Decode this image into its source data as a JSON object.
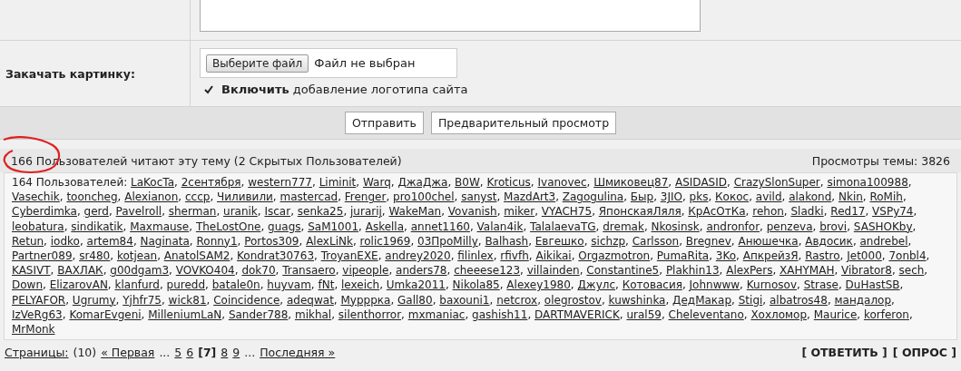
{
  "form": {
    "upload_label": "Закачать картинку:",
    "file_button": "Выберите файл",
    "file_status": "Файл не выбран",
    "logo_checkbox": {
      "label": "**Включить** добавление логотипа сайта",
      "checked": true
    },
    "buttons": [
      "Отправить",
      "Предварительный просмотр"
    ]
  },
  "readers": {
    "title": "166 Пользователей читают эту тему (2 Скрытых Пользователей)",
    "views": "Просмотры темы: 3826",
    "prefix": "164 Пользователей:",
    "separator": ",",
    "users": [
      "LaKocTa",
      "2сентября",
      "western777",
      "Liminit",
      "Warq",
      "ДжаДжа",
      "B0W",
      "Kroticus",
      "Ivanovec",
      "Шмиковец87",
      "ASIDASID",
      "CrazySlonSuper",
      "simona100988",
      "Vasechik",
      "tooncheg",
      "Alexianon",
      "cccp",
      "Чиливили",
      "mastercad",
      "Frenger",
      "pro100chel",
      "sanyst",
      "MazdArt3",
      "Zagogulina",
      "Быр",
      "3JIO",
      "pks",
      "Кокос",
      "avild",
      "alakond",
      "Nkin",
      "RoMih",
      "Cyberdimka",
      "gerd",
      "Pavelroll",
      "sherman",
      "uranik",
      "Iscar",
      "senka25",
      "jurarij",
      "WakeMan",
      "Vovanish",
      "miker",
      "VYACH75",
      "ЯпонскаяЛяля",
      "КрАсОтКа",
      "rehon",
      "Sladki",
      "Red17",
      "VSPy74",
      "leobatura",
      "sindikatik",
      "Maxmause",
      "TheLostOne",
      "guags",
      "SaM1001",
      "Askella",
      "annet1160",
      "Valan4ik",
      "TalalaevaTG",
      "dremak",
      "Nkosinsk",
      "andronfor",
      "penzeva",
      "brovi",
      "SASHOKby",
      "Retun",
      "iodko",
      "artem84",
      "Naginata",
      "Ronny1",
      "Portos309",
      "AlexLiNk",
      "rolic1969",
      "03ПроMilly",
      "Balhash",
      "Евгешко",
      "sichzp",
      "Carlsson",
      "Bregnev",
      "Анюшечка",
      "Авдосик",
      "andrebel",
      "Partner089",
      "sr480",
      "kotjean",
      "AnatolSAM2",
      "Kondrat30763",
      "TroyanEXE",
      "andrey2020",
      "filinlex",
      "rfivfh",
      "Aikikai",
      "Orgazmotron",
      "PumaRita",
      "3Ko",
      "АпкрейзЯ",
      "Rastro",
      "Jet000",
      "7onbl4",
      "KASIVT",
      "ВАХЛАК",
      "g00dgam3",
      "VOVKO404",
      "dok70",
      "Transaero",
      "vipeople",
      "anders78",
      "cheeese123",
      "villainden",
      "Constantine5",
      "Plakhin13",
      "AlexPers",
      "XAHYMAH",
      "Vibrator8",
      "sech",
      "Down",
      "ElizarovAN",
      "klanfurd",
      "puredd",
      "batale0n",
      "huyvam",
      "fNt",
      "lexeich",
      "Umka2011",
      "Nikola85",
      "Alexey1980",
      "Джулс",
      "Котовасия",
      "Johnwww",
      "Kurnosov",
      "Strase",
      "DuHastSB",
      "PELYAFOR",
      "Ugrumy",
      "Yjhfr75",
      "wick81",
      "Coincidence",
      "adeqwat",
      "Мурррка",
      "Gall80",
      "baxouni1",
      "netcrox",
      "olegrostov",
      "kuwshinka",
      "ДедМакар",
      "Stigi",
      "albatros48",
      "мандалор",
      "IzVeRg63",
      "KomarEvgeni",
      "MilleniumLaN",
      "Sander788",
      "mikhal",
      "silenthorror",
      "mxmaniac",
      "gashish11",
      "DARTMAVERICK",
      "ural59",
      "Cheleventano",
      "Хохломор",
      "Maurice",
      "korferon",
      "MrMonk"
    ]
  },
  "pagination": {
    "label": "Страницы:",
    "total": "(10)",
    "items": [
      {
        "text": "« Первая",
        "kind": "link"
      },
      {
        "text": "...",
        "kind": "ellipsis"
      },
      {
        "text": "5",
        "kind": "link"
      },
      {
        "text": "6",
        "kind": "link"
      },
      {
        "text": "[7]",
        "kind": "current"
      },
      {
        "text": "8",
        "kind": "link"
      },
      {
        "text": "9",
        "kind": "link"
      },
      {
        "text": "...",
        "kind": "ellipsis"
      },
      {
        "text": "Последняя »",
        "kind": "link"
      }
    ]
  },
  "actions": [
    "[ ОТВЕТИТЬ ]",
    "[ ОПРОС ]"
  ]
}
